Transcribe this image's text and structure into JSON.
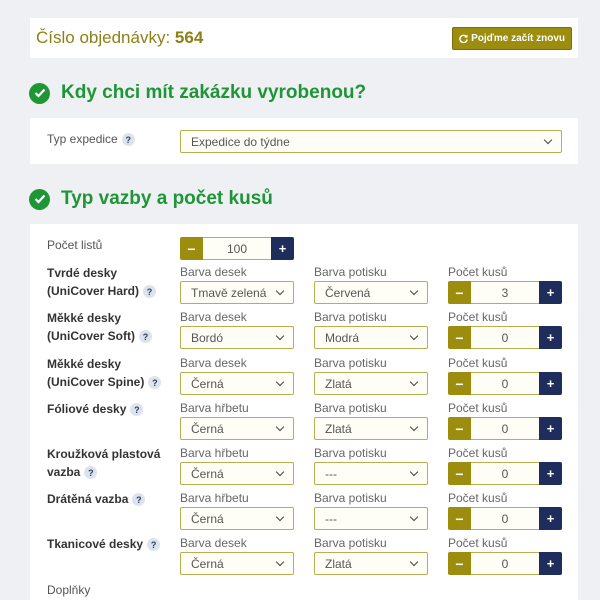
{
  "header": {
    "order_label": "Číslo objednávky:",
    "order_number": "564",
    "restart_label": "Pojďme začít znovu"
  },
  "section1": {
    "title": "Kdy chci mít zakázku vyrobenou?",
    "expedition_label": "Typ expedice",
    "expedition_value": "Expedice do týdne"
  },
  "section2": {
    "title": "Typ vazby a počet kusů",
    "sheets_label": "Počet listů",
    "sheets_value": "100",
    "rows": [
      {
        "name": "Tvrdé desky (UniCover Hard)",
        "c1_label": "Barva desek",
        "c1_value": "Tmavě zelená",
        "c2_label": "Barva potisku",
        "c2_value": "Červená",
        "qty_label": "Počet kusů",
        "qty": "3"
      },
      {
        "name": "Měkké desky (UniCover Soft)",
        "c1_label": "Barva desek",
        "c1_value": "Bordó",
        "c2_label": "Barva potisku",
        "c2_value": "Modrá",
        "qty_label": "Počet kusů",
        "qty": "0"
      },
      {
        "name": "Měkké desky (UniCover Spine)",
        "c1_label": "Barva desek",
        "c1_value": "Černá",
        "c2_label": "Barva potisku",
        "c2_value": "Zlatá",
        "qty_label": "Počet kusů",
        "qty": "0"
      },
      {
        "name": "Fóliové desky",
        "c1_label": "Barva hřbetu",
        "c1_value": "Černá",
        "c2_label": "Barva potisku",
        "c2_value": "Zlatá",
        "qty_label": "Počet kusů",
        "qty": "0"
      },
      {
        "name": "Kroužková plastová vazba",
        "c1_label": "Barva hřbetu",
        "c1_value": "Černá",
        "c2_label": "Barva potisku",
        "c2_value": "---",
        "qty_label": "Počet kusů",
        "qty": "0"
      },
      {
        "name": "Drátěná vazba",
        "c1_label": "Barva hřbetu",
        "c1_value": "Černá",
        "c2_label": "Barva potisku",
        "c2_value": "---",
        "qty_label": "Počet kusů",
        "qty": "0"
      },
      {
        "name": "Tkanicové desky",
        "c1_label": "Barva desek",
        "c1_value": "Černá",
        "c2_label": "Barva potisku",
        "c2_value": "Zlatá",
        "qty_label": "Počet kusů",
        "qty": "0"
      }
    ],
    "extras_label": "Doplňky"
  },
  "icons": {
    "help": "?",
    "minus": "−",
    "plus": "+",
    "restart": "refresh-icon",
    "check": "check-circle-icon"
  },
  "colors": {
    "accent_gold": "#9c8d0e",
    "navy": "#1e2d5c",
    "green": "#1e9636"
  }
}
